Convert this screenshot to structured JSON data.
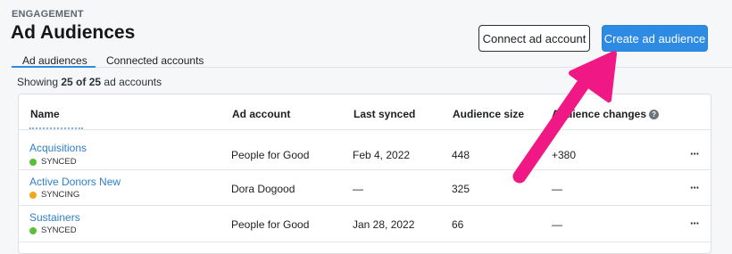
{
  "header": {
    "eyebrow": "ENGAGEMENT",
    "title": "Ad Audiences",
    "connect_label": "Connect ad account",
    "create_label": "Create ad audience"
  },
  "tabs": [
    {
      "label": "Ad audiences",
      "active": true
    },
    {
      "label": "Connected accounts",
      "active": false
    }
  ],
  "showing": {
    "prefix": "Showing ",
    "count": "25 of 25",
    "suffix": " ad accounts"
  },
  "table": {
    "columns": [
      "Name",
      "Ad account",
      "Last synced",
      "Audience size",
      "Audience changes"
    ],
    "rows": [
      {
        "name": "Acquisitions",
        "status": "SYNCED",
        "ad_account": "People for Good",
        "last_synced": "Feb 4, 2022",
        "size": "448",
        "changes": "+380"
      },
      {
        "name": "Active Donors New",
        "status": "SYNCING",
        "ad_account": "Dora Dogood",
        "last_synced": "—",
        "size": "325",
        "changes": "—"
      },
      {
        "name": "Sustainers",
        "status": "SYNCED",
        "ad_account": "People for Good",
        "last_synced": "Jan 28, 2022",
        "size": "66",
        "changes": "—"
      }
    ],
    "more_glyph": "···"
  },
  "colors": {
    "accent": "#2e8be3",
    "synced": "#5bbf3a",
    "syncing": "#f2a81d",
    "annotation_arrow": "#f01884"
  },
  "icons": {
    "help": "question-circle-icon",
    "more": "ellipsis-icon",
    "annotation": "arrow-icon"
  }
}
